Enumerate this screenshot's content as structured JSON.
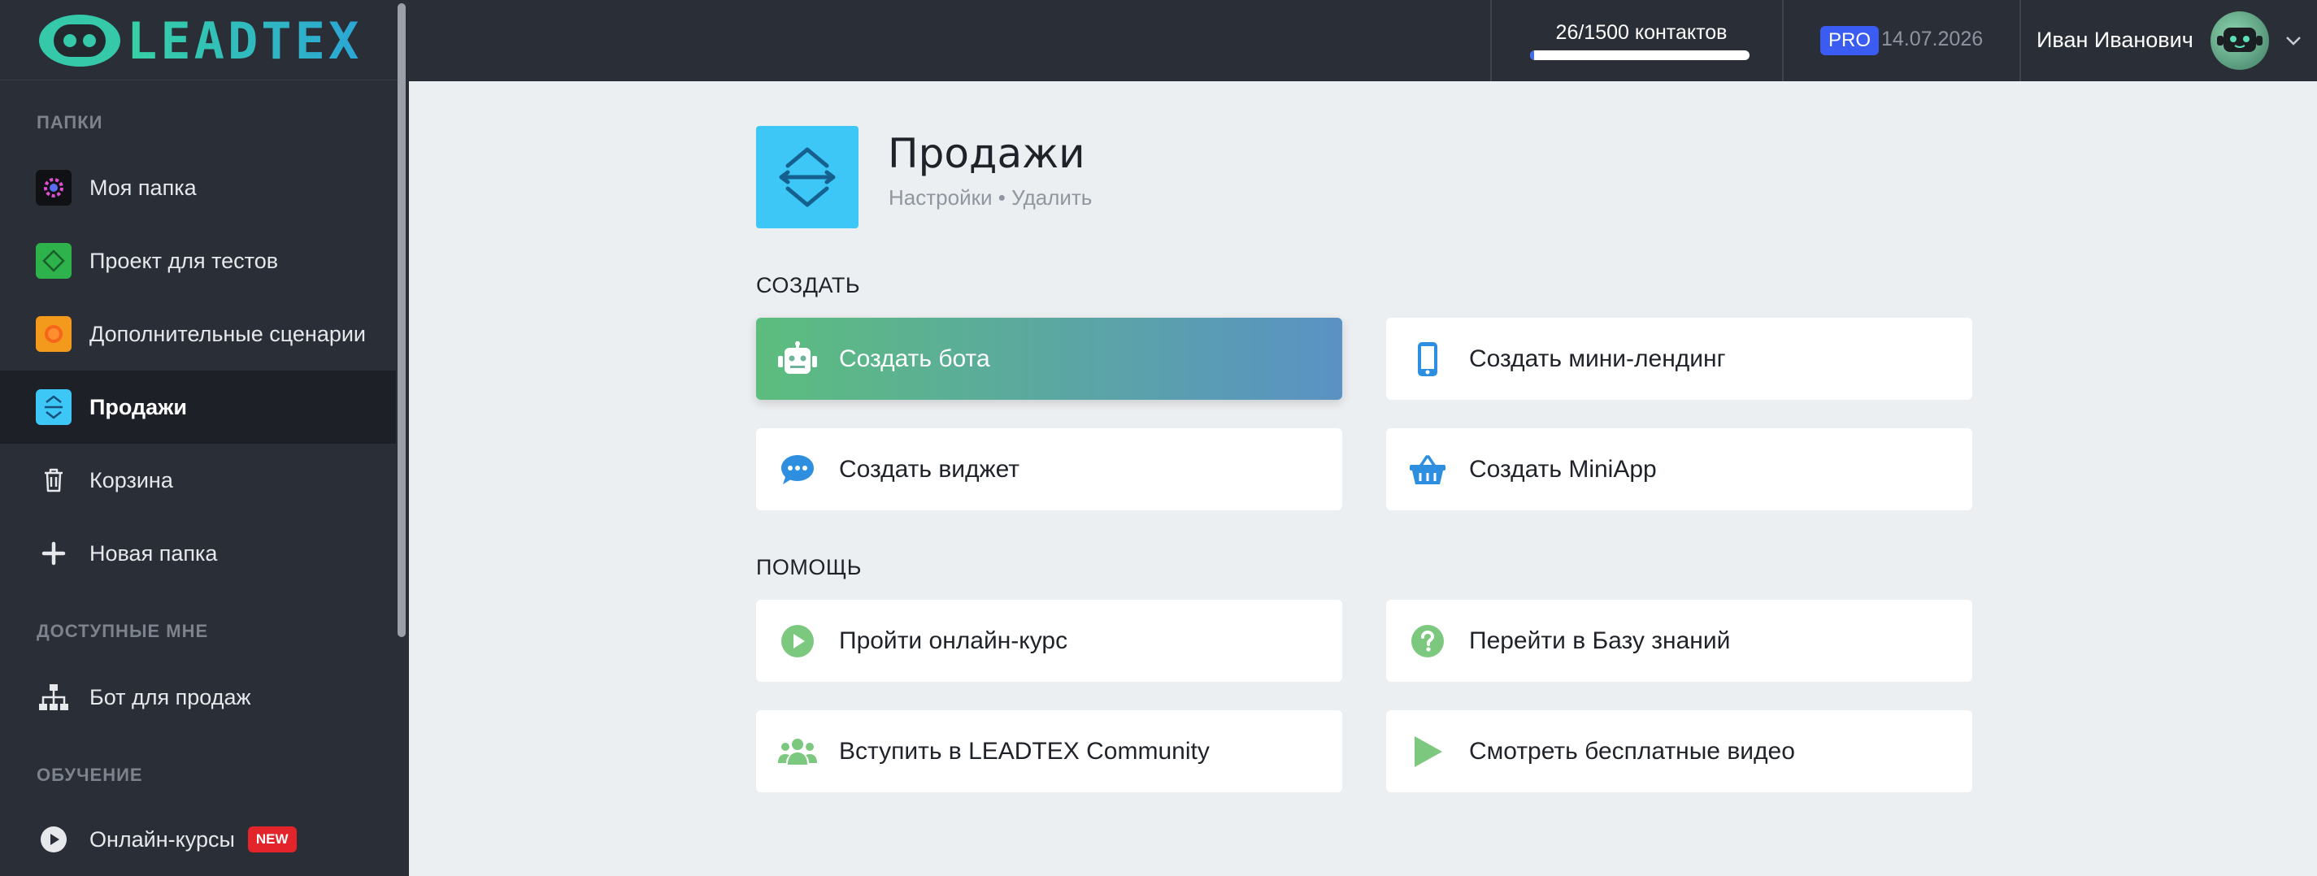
{
  "brand": {
    "logo_text": "LEADTEX"
  },
  "sidebar": {
    "sections": {
      "folders": "ПАПКИ",
      "shared": "ДОСТУПНЫЕ МНЕ",
      "learning": "ОБУЧЕНИЕ"
    },
    "folders": [
      {
        "label": "Моя папка",
        "icon": "gear-folder-icon"
      },
      {
        "label": "Проект для тестов",
        "icon": "diamond-folder-icon"
      },
      {
        "label": "Дополнительные сценарии",
        "icon": "orange-circle-folder-icon"
      },
      {
        "label": "Продажи",
        "icon": "sales-folder-icon",
        "active": true
      },
      {
        "label": "Корзина",
        "icon": "trash-icon"
      },
      {
        "label": "Новая папка",
        "icon": "plus-icon"
      }
    ],
    "shared": [
      {
        "label": "Бот для продаж",
        "icon": "sitemap-icon"
      }
    ],
    "learning": [
      {
        "label": "Онлайн-курсы",
        "icon": "play-circle-icon",
        "badge": "NEW"
      }
    ]
  },
  "topbar": {
    "contacts_label": "26/1500 контактов",
    "contacts_used": 26,
    "contacts_total": 1500,
    "plan": "PRO",
    "plan_date": "14.07.2026",
    "user_name": "Иван Иванович"
  },
  "folder": {
    "title": "Продажи",
    "settings_link": "Настройки",
    "separator": "•",
    "delete_link": "Удалить"
  },
  "create": {
    "title": "СОЗДАТЬ",
    "items": [
      {
        "label": "Создать бота",
        "icon": "robot-icon"
      },
      {
        "label": "Создать мини-лендинг",
        "icon": "mobile-icon"
      },
      {
        "label": "Создать виджет",
        "icon": "chat-bubble-icon"
      },
      {
        "label": "Создать MiniApp",
        "icon": "basket-icon"
      }
    ]
  },
  "help": {
    "title": "ПОМОЩЬ",
    "items": [
      {
        "label": "Пройти онлайн-курс",
        "icon": "play-circle-icon"
      },
      {
        "label": "Перейти в Базу знаний",
        "icon": "question-circle-icon"
      },
      {
        "label": "Вступить в LEADTEX Community",
        "icon": "users-icon"
      },
      {
        "label": "Смотреть бесплатные видео",
        "icon": "play-triangle-icon"
      }
    ]
  },
  "colors": {
    "sidebar_bg": "#2a2e36",
    "accent_green": "#5cbd7e",
    "accent_blue": "#3b5cf2",
    "folder_icon": "#3cc7f6",
    "new_badge": "#e3242b",
    "help_icon_green": "#7dc87f",
    "create_icon_blue": "#2e8fe0"
  }
}
